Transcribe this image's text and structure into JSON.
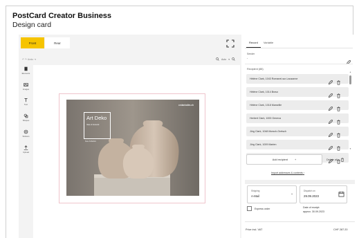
{
  "app": {
    "title": "PostCard Creator Business",
    "page_title": "Design card"
  },
  "editor": {
    "side_tabs": [
      "Front",
      "Rear"
    ],
    "undo_label": "↶ ↷ Undo   ⇥",
    "zoom_label": "Auto",
    "tools": [
      {
        "label": "Elements",
        "icon": "layers-icon"
      },
      {
        "label": "Images",
        "icon": "image-icon"
      },
      {
        "label": "Text",
        "icon": "text-icon"
      },
      {
        "label": "Shapes",
        "icon": "shapes-icon"
      },
      {
        "label": "Stickers",
        "icon": "sticker-icon"
      },
      {
        "label": "Upload",
        "icon": "upload-icon"
      }
    ],
    "card": {
      "brand": "cedankallm.ch",
      "art_title": "Art Deko",
      "art_subtitle": "Vase & Keramik",
      "art_line": "Neue Kollektion"
    },
    "colors": {
      "active_tab": "#f6c400",
      "card_outline": "#efc4cc",
      "photo_bg": "#8b857f"
    }
  },
  "panel": {
    "tabs": [
      "Record",
      "Variable"
    ],
    "sender_label": "Sender",
    "sender_value": "-",
    "recipients_title": "Recipient (88)",
    "recipients": [
      "Hélène Clark, 1043 Romanel-sur-Lausanne",
      "Hélène Clark, 1014 Bravo",
      "Hélène Clark, 1018 Marseille",
      "Herbert Clark, 1000 Geneva",
      "Jörg Clark, 1048 Morsch-Gretsch",
      "Jörg Clark, 1009 Marten",
      "Jörg Clark, 1001 Bravo"
    ],
    "add_recipient_label": "Add recipient",
    "delete_all_label": "Delete all",
    "import_label": "Import addresses & contents",
    "shipping_label": "Shipping",
    "shipping_value": "A-Mail",
    "dispatch_label": "Dispatch on",
    "dispatch_value": "29.09.2023",
    "express_label": "Express order",
    "receipt_label": "Date of receipt:",
    "receipt_date": "approx. 30.09.2023",
    "price_label": "Price incl. VAT",
    "price_value": "CHF 287.20"
  }
}
